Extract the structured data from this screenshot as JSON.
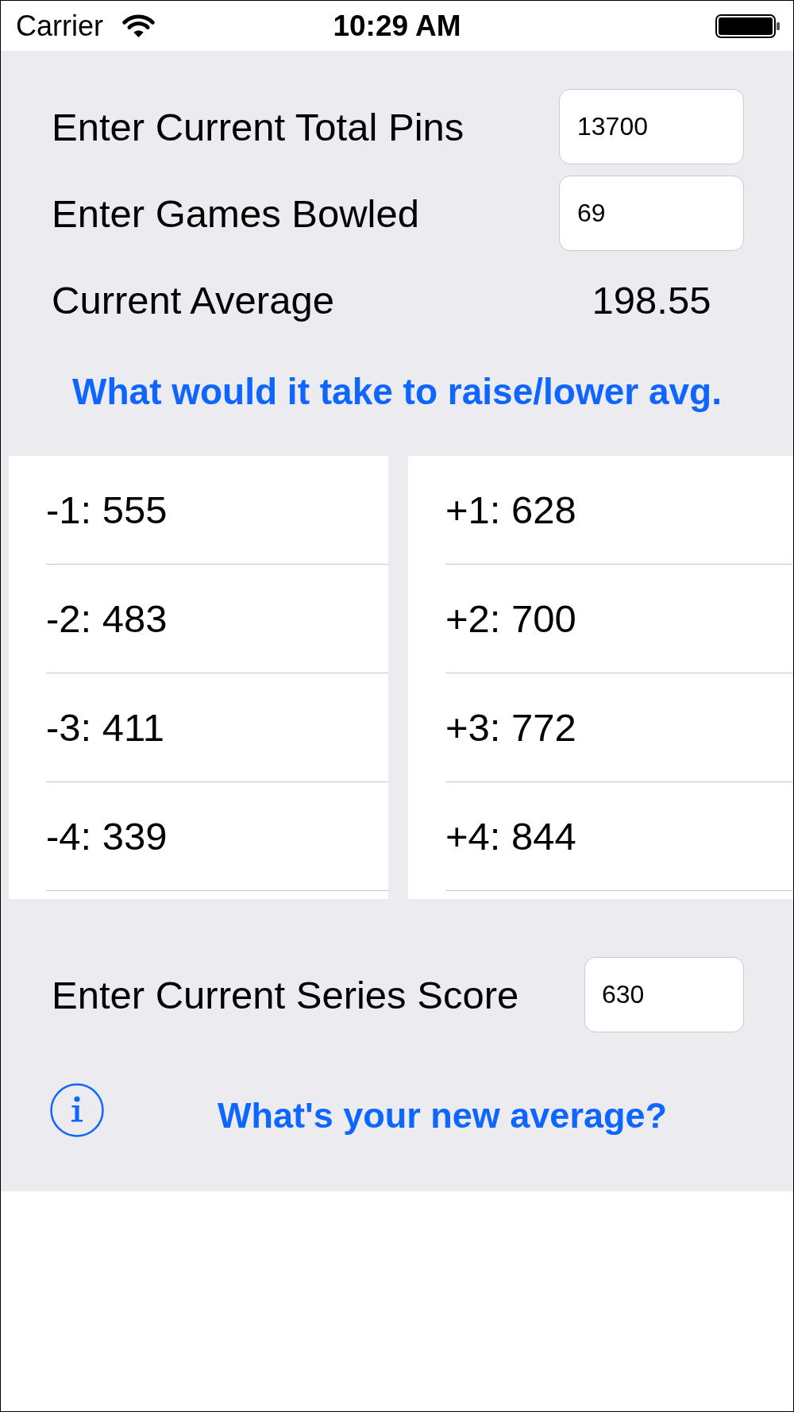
{
  "status_bar": {
    "carrier": "Carrier",
    "time": "10:29 AM"
  },
  "inputs": [
    {
      "label": "Enter Current Total Pins",
      "value": "13700"
    },
    {
      "label": "Enter Games Bowled",
      "value": "69"
    }
  ],
  "current_average": {
    "label": "Current Average",
    "value": "198.55"
  },
  "raise_lower_button": "What would it take to raise/lower avg.",
  "lists": [
    {
      "rows": [
        "-1: 555",
        "-2: 483",
        "-3: 411",
        "-4: 339"
      ]
    },
    {
      "rows": [
        "+1: 628",
        "+2: 700",
        "+3: 772",
        "+4: 844"
      ]
    }
  ],
  "series": {
    "label": "Enter Current Series Score",
    "value": "630"
  },
  "new_average_button": "What's your new average?"
}
